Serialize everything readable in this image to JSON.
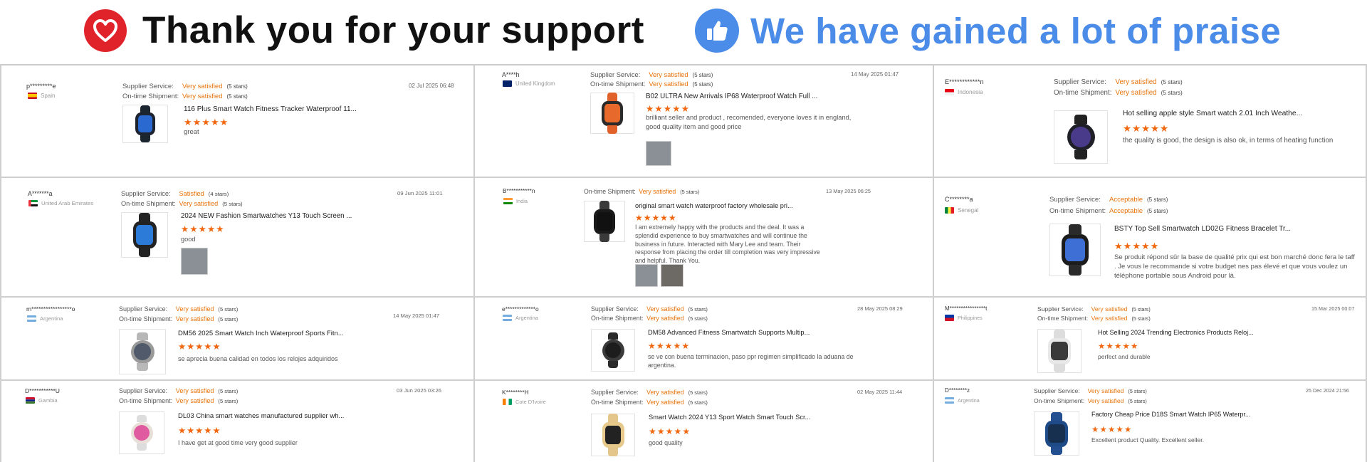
{
  "banner": {
    "left_icon": "heart-icon",
    "left_title": "Thank you for your support",
    "right_icon": "thumbs-up-icon",
    "right_title": "We have gained a lot of praise"
  },
  "colors": {
    "heart_red": "#e0232b",
    "praise_blue": "#4a8ce8",
    "rating_orange": "#e8730b",
    "star_orange": "#f0670f"
  },
  "labels": {
    "supplier_service": "Supplier Service:",
    "ontime_shipment": "On-time Shipment:"
  },
  "reviews": [
    {
      "buyer": "p*********e",
      "country": "Spain",
      "date": "02 Jul 2025 06:48",
      "supplier_rating": "Very satisfied",
      "supplier_stars": "(5 stars)",
      "shipment_rating": "Very satisfied",
      "shipment_stars": "(5 stars)",
      "product": "116 Plus Smart Watch Fitness Tracker Waterproof 11...",
      "rating": 5,
      "comment": "great",
      "photos": 0
    },
    {
      "buyer": "A****h",
      "country": "United Kingdom",
      "date": "14 May 2025 01:47",
      "supplier_rating": "Very satisfied",
      "supplier_stars": "(5 stars)",
      "shipment_rating": "Very satisfied",
      "shipment_stars": "(5 stars)",
      "product": "B02 ULTRA New Arrivals IP68 Waterproof Watch Full ...",
      "rating": 5,
      "comment": "brilliant seller and product , recomended, everyone loves it in england, good quality item and good price",
      "photos": 1
    },
    {
      "buyer": "E************n",
      "country": "Indonesia",
      "date": "",
      "supplier_rating": "Very satisfied",
      "supplier_stars": "(5 stars)",
      "shipment_rating": "Very satisfied",
      "shipment_stars": "(5 stars)",
      "product": "Hot selling apple style Smart watch 2.01 Inch Weathe...",
      "rating": 5,
      "comment": "the quality is good, the design is also ok, in terms of heating function",
      "photos": 0
    },
    {
      "buyer": "A*******a",
      "country": "United Arab Emirates",
      "date": "09 Jun 2025 11:01",
      "supplier_rating": "Satisfied",
      "supplier_stars": "(4 stars)",
      "shipment_rating": "Very satisfied",
      "shipment_stars": "(5 stars)",
      "product": "2024 NEW Fashion Smartwatches Y13 Touch Screen ...",
      "rating": 5,
      "comment": "good",
      "photos": 1
    },
    {
      "buyer": "B***********n",
      "country": "India",
      "date": "13 May 2025 06:25",
      "supplier_rating": "",
      "supplier_stars": "",
      "shipment_rating": "Very satisfied",
      "shipment_stars": "(5 stars)",
      "product": "original smart watch waterproof factory wholesale pri...",
      "rating": 5,
      "comment": "I am extremely happy with the products and the deal. It was a splendid experience to buy smartwatches and will continue the business in future. Interacted with Mary Lee and team. Their response from placing the order till completion was very impressive and helpful. Thank You.",
      "photos": 2
    },
    {
      "buyer": "C********a",
      "country": "Senegal",
      "date": "",
      "supplier_rating": "Acceptable",
      "supplier_stars": "(5 stars)",
      "shipment_rating": "Acceptable",
      "shipment_stars": "(5 stars)",
      "product": "BSTY Top Sell Smartwatch LD02G Fitness Bracelet Tr...",
      "rating": 5,
      "comment": "Se produit répond sûr la base de qualité prix qui est bon marché donc fera le taff . Je vous le recommande si votre budget nes pas élevé et que vous voulez un téléphone portable sous Android pour là.",
      "photos": 0
    },
    {
      "buyer": "m*****************o",
      "country": "Argentina",
      "date": "14 May 2025 01:47",
      "supplier_rating": "Very satisfied",
      "supplier_stars": "(5 stars)",
      "shipment_rating": "Very satisfied",
      "shipment_stars": "(5 stars)",
      "product": "DM56 2025 Smart Watch Inch Waterproof Sports Fitn...",
      "rating": 5,
      "comment": "se aprecia buena calidad en todos los relojes adquiridos",
      "photos": 0
    },
    {
      "buyer": "e*************o",
      "country": "Argentina",
      "date": "28 May 2025 08:29",
      "supplier_rating": "Very satisfied",
      "supplier_stars": "(5 stars)",
      "shipment_rating": "Very satisfied",
      "shipment_stars": "(5 stars)",
      "product": " DM58 Advanced Fitness Smartwatch Supports Multip...",
      "rating": 5,
      "comment": "se ve con buena terminacion, paso ppr regimen simplificado la aduana de argentina.",
      "photos": 0
    },
    {
      "buyer": "M****************t",
      "country": "Philippines",
      "date": "15 Mar 2025 00:07",
      "supplier_rating": "Very satisfied",
      "supplier_stars": "(5 stars)",
      "shipment_rating": "Very satisfied",
      "shipment_stars": "(5 stars)",
      "product": "Hot Selling 2024 Trending Electronics Products Reloj...",
      "rating": 5,
      "comment": "perfect and durable",
      "photos": 0
    },
    {
      "buyer": "D***********U",
      "country": "Gambia",
      "date": "03 Jun 2025 03:26",
      "supplier_rating": "Very satisfied",
      "supplier_stars": "(5 stars)",
      "shipment_rating": "Very satisfied",
      "shipment_stars": "(5 stars)",
      "product": "DL03 China smart watches manufactured supplier wh...",
      "rating": 5,
      "comment": "I have get at good time very good supplier",
      "photos": 0
    },
    {
      "buyer": "K********H",
      "country": "Cote D'Ivoire",
      "date": "02 May 2025 11:44",
      "supplier_rating": "Very satisfied",
      "supplier_stars": "(5 stars)",
      "shipment_rating": "Very satisfied",
      "shipment_stars": "(5 stars)",
      "product": "Smart Watch 2024 Y13 Sport Watch Smart Touch Scr...",
      "rating": 5,
      "comment": "good quality",
      "photos": 0
    },
    {
      "buyer": "D********z",
      "country": "Argentina",
      "date": "25 Dec 2024 21:56",
      "supplier_rating": "Very satisfied",
      "supplier_stars": "(5 stars)",
      "shipment_rating": "Very satisfied",
      "shipment_stars": "(5 stars)",
      "product": "Factory Cheap Price D18S Smart Watch IP65 Waterpr...",
      "rating": 5,
      "comment": "Excellent product Quality. Excellent seller.",
      "photos": 0
    }
  ]
}
